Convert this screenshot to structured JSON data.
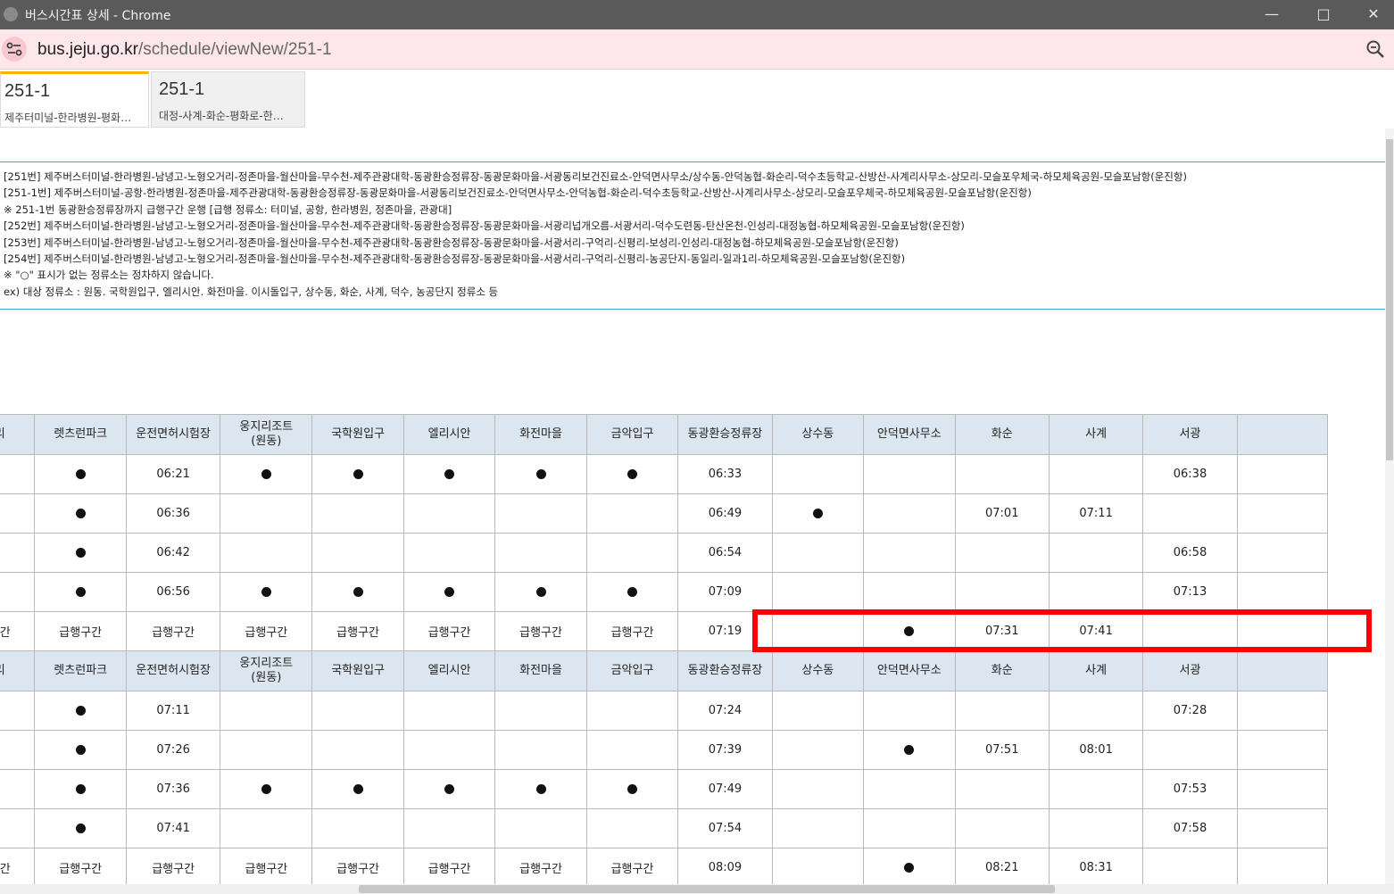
{
  "window": {
    "title": "버스시간표 상세 - Chrome",
    "controls": [
      "minimize",
      "maximize",
      "close"
    ]
  },
  "address": {
    "host": "bus.jeju.go.kr",
    "path": "/schedule/viewNew/251-1"
  },
  "tabs": [
    {
      "number": "251-1",
      "route": "제주터미널-한라병원-평화…"
    },
    {
      "number": "251-1",
      "route": "대정-사계-화순-평화로-한…"
    }
  ],
  "info_lines": [
    "[251번] 제주버스터미널-한라병원-남녕고-노형오거리-정존마을-월산마을-무수천-제주관광대학-동광환승정류장-동광문화마을-서광동리보건진료소-안덕면사무소/상수동-안덕농협-화순리-덕수초등학교-산방산-사계리사무소-상모리-모슬포우체국-하모체육공원-모슬포남항(운진항)",
    "[251-1번] 제주버스터미널-공항-한라병원-정존마을-제주관광대학-동광환승정류장-동광문화마을-서광동리보건진료소-안덕면사무소-안덕농협-화순리-덕수초등학교-산방산-사계리사무소-상모리-모슬포우체국-하모체육공원-모슬포남항(운진항)",
    "※ 251-1번 동광환승정류장까지 급행구간 운행 [급행 정류소: 터미널, 공항, 한라병원, 정존마을, 관광대]",
    "[252번] 제주버스터미널-한라병원-남녕고-노형오거리-정존마을-월산마을-무수천-제주관광대학-동광환승정류장-동광문화마을-서광리넙개오름-서광서리-덕수도련동-탄산온천-인성리-대정농협-하모체육공원-모슬포남항(운진항)",
    "[253번] 제주버스터미널-한라병원-남녕고-노형오거리-정존마을-월산마을-무수천-제주관광대학-동광환승정류장-동광문화마을-서광서리-구억리-신평리-보성리-인성리-대정농협-하모체육공원-모슬포남항(운진항)",
    "[254번] 제주버스터미널-한라병원-남녕고-노형오거리-정존마을-월산마을-무수천-제주관광대학-동광환승정류장-동광문화마을-서광서리-구억리-신평리-농공단지-동일리-일과1리-하모체육공원-모슬포남항(운진항)",
    "※ \"○\" 표시가 없는 정류소는 정차하지 않습니다.",
    "ex) 대상 정류소 : 원동. 국학원입구, 엘리시안. 화전마을. 이시돌입구, 상수동, 화순, 사계, 덕수, 농공단지 정류소 등"
  ],
  "dot_symbol": "●",
  "table": {
    "headers": [
      "월산리",
      "렛츠런파크",
      "운전면허시험장",
      "웅지리조트\n(원동)",
      "국학원입구",
      "엘리시안",
      "화전마을",
      "금악입구",
      "동광환승정류장",
      "상수동",
      "안덕면사무소",
      "화순",
      "사계",
      "서광",
      ""
    ],
    "rows": [
      {
        "type": "data",
        "cells": [
          "",
          "●",
          "06:21",
          "●",
          "●",
          "●",
          "●",
          "●",
          "06:33",
          "",
          "",
          "",
          "",
          "06:38",
          ""
        ]
      },
      {
        "type": "data",
        "cells": [
          "",
          "●",
          "06:36",
          "",
          "",
          "",
          "",
          "",
          "06:49",
          "●",
          "",
          "07:01",
          "07:11",
          "",
          ""
        ]
      },
      {
        "type": "data",
        "cells": [
          "",
          "●",
          "06:42",
          "",
          "",
          "",
          "",
          "",
          "06:54",
          "",
          "",
          "",
          "",
          "06:58",
          ""
        ]
      },
      {
        "type": "data",
        "cells": [
          "",
          "●",
          "06:56",
          "●",
          "●",
          "●",
          "●",
          "●",
          "07:09",
          "",
          "",
          "",
          "",
          "07:13",
          ""
        ]
      },
      {
        "type": "data",
        "cells": [
          "급행구간",
          "급행구간",
          "급행구간",
          "급행구간",
          "급행구간",
          "급행구간",
          "급행구간",
          "급행구간",
          "07:19",
          "",
          "●",
          "07:31",
          "07:41",
          "",
          ""
        ]
      },
      {
        "type": "header"
      },
      {
        "type": "data",
        "cells": [
          "",
          "●",
          "07:11",
          "",
          "",
          "",
          "",
          "",
          "07:24",
          "",
          "",
          "",
          "",
          "07:28",
          ""
        ]
      },
      {
        "type": "data",
        "cells": [
          "",
          "●",
          "07:26",
          "",
          "",
          "",
          "",
          "",
          "07:39",
          "",
          "●",
          "07:51",
          "08:01",
          "",
          ""
        ]
      },
      {
        "type": "data",
        "cells": [
          "",
          "●",
          "07:36",
          "●",
          "●",
          "●",
          "●",
          "●",
          "07:49",
          "",
          "",
          "",
          "",
          "07:53",
          ""
        ]
      },
      {
        "type": "data",
        "cells": [
          "",
          "●",
          "07:41",
          "",
          "",
          "",
          "",
          "",
          "07:54",
          "",
          "",
          "",
          "",
          "07:58",
          ""
        ]
      },
      {
        "type": "data",
        "cells": [
          "급행구간",
          "급행구간",
          "급행구간",
          "급행구간",
          "급행구간",
          "급행구간",
          "급행구간",
          "급행구간",
          "08:09",
          "",
          "●",
          "08:21",
          "08:31",
          "",
          ""
        ]
      }
    ]
  },
  "colors": {
    "title_bar": "#5a5a5a",
    "address_bar": "#fde7ea",
    "header_cell": "#dce6f1",
    "info_border": "#39a6c2",
    "highlight": "#ff0000",
    "active_tab": "#f4b400"
  }
}
